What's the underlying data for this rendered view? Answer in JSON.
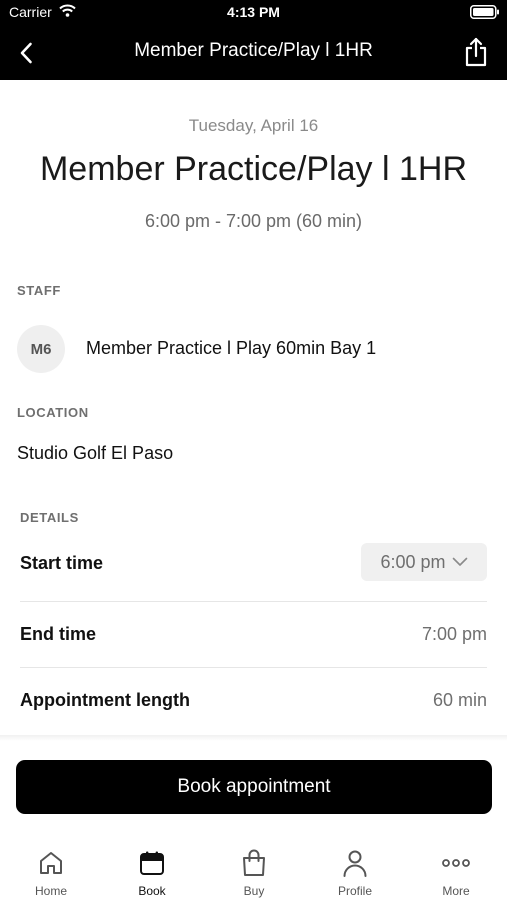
{
  "status_bar": {
    "carrier": "Carrier",
    "time": "4:13 PM"
  },
  "nav": {
    "title": "Member Practice/Play l 1HR"
  },
  "header": {
    "date": "Tuesday, April 16",
    "title": "Member Practice/Play l 1HR",
    "time_range": "6:00 pm - 7:00 pm (60 min)"
  },
  "staff": {
    "label": "STAFF",
    "initials": "M6",
    "name": "Member Practice l Play 60min Bay 1"
  },
  "location": {
    "label": "LOCATION",
    "name": "Studio Golf El Paso"
  },
  "details": {
    "label": "DETAILS",
    "start_time": {
      "label": "Start time",
      "value": "6:00 pm"
    },
    "end_time": {
      "label": "End time",
      "value": "7:00 pm"
    },
    "length": {
      "label": "Appointment length",
      "value": "60 min"
    }
  },
  "book_button": "Book appointment",
  "tabs": [
    {
      "label": "Home",
      "icon": "home-icon"
    },
    {
      "label": "Book",
      "icon": "calendar-icon",
      "active": true
    },
    {
      "label": "Buy",
      "icon": "shopping-bag-icon"
    },
    {
      "label": "Profile",
      "icon": "person-icon"
    },
    {
      "label": "More",
      "icon": "more-dots-icon"
    }
  ]
}
